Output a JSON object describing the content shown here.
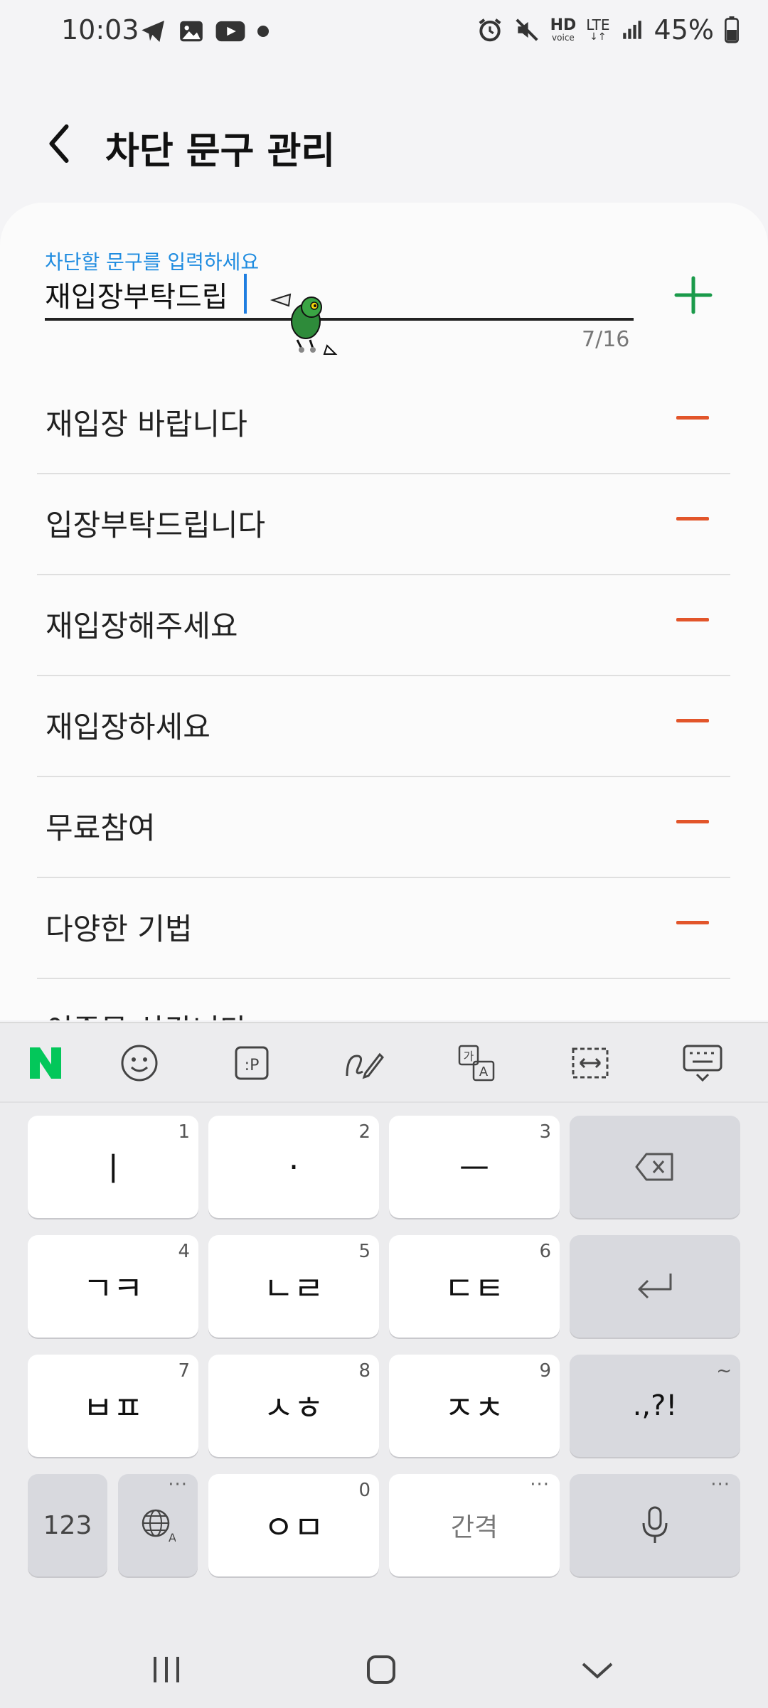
{
  "status_bar": {
    "time": "10:03",
    "battery": "45%",
    "icons_left": [
      "telegram-icon",
      "gallery-icon",
      "youtube-icon",
      "dot-icon"
    ],
    "icons_right": [
      "alarm-icon",
      "mute-icon",
      "hd-voice-icon",
      "lte-icon",
      "signal-icon",
      "battery-icon"
    ],
    "hd_label": "HD",
    "voice_label": "voice",
    "lte_label": "LTE"
  },
  "header": {
    "title": "차단 문구 관리"
  },
  "input": {
    "label": "차단할 문구를 입력하세요",
    "value": "재입장부탁드립",
    "counter": "7/16"
  },
  "colors": {
    "accent_blue": "#1f8ce0",
    "add_green": "#1a9a4a",
    "remove_red": "#e2552a",
    "naver_green": "#03c75a"
  },
  "blocked_phrases": [
    {
      "label": "재입장 바랍니다"
    },
    {
      "label": "입장부탁드립니다"
    },
    {
      "label": "재입장해주세요"
    },
    {
      "label": "재입장하세요"
    },
    {
      "label": "무료참여"
    },
    {
      "label": "다양한 기법"
    },
    {
      "label": "이종목 상갑니다"
    }
  ],
  "keyboard": {
    "toolbar": [
      "naver-n-icon",
      "emoji-icon",
      "clipboard-icon",
      "handwriting-icon",
      "translate-icon",
      "text-select-icon",
      "hide-keyboard-icon"
    ],
    "rows": [
      [
        {
          "label": "ㅣ",
          "num": "1"
        },
        {
          "label": "·",
          "num": "2"
        },
        {
          "label": "ㅡ",
          "num": "3"
        }
      ],
      [
        {
          "label": "ㄱㅋ",
          "num": "4"
        },
        {
          "label": "ㄴㄹ",
          "num": "5"
        },
        {
          "label": "ㄷㅌ",
          "num": "6"
        }
      ],
      [
        {
          "label": "ㅂㅍ",
          "num": "7"
        },
        {
          "label": "ㅅㅎ",
          "num": "8"
        },
        {
          "label": "ㅈㅊ",
          "num": "9"
        }
      ]
    ],
    "punct": ".,?!",
    "punct_hint": "~",
    "num_key": "123",
    "zero_key": {
      "label": "ㅇㅁ",
      "num": "0"
    },
    "space": "간격",
    "dots": "···"
  },
  "nav_bar": [
    "recents-icon",
    "home-icon",
    "back-chevron-icon"
  ]
}
